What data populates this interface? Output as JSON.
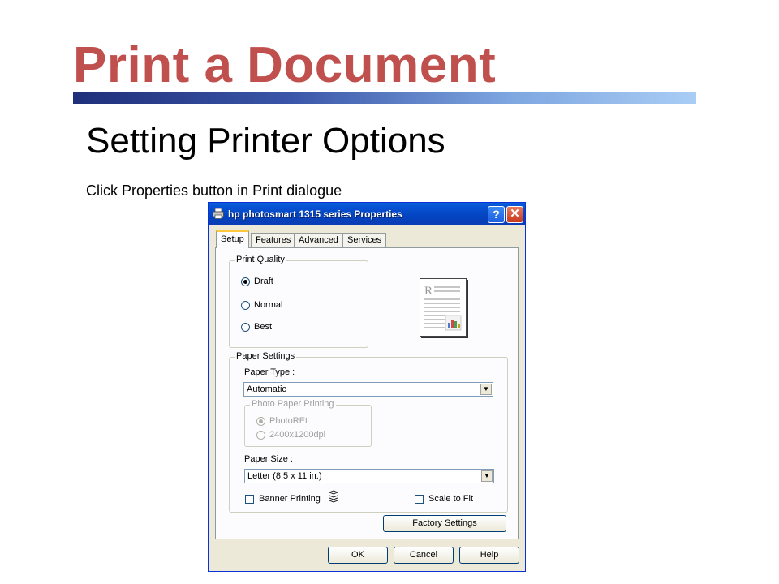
{
  "slide": {
    "title": "Print a Document",
    "subtitle": "Setting Printer Options",
    "instruction": "Click Properties button in Print dialogue"
  },
  "dialog": {
    "title": "hp photosmart 1315 series Properties",
    "help_button": "?",
    "close_button": "✕",
    "tabs": [
      {
        "label": "Setup",
        "active": true
      },
      {
        "label": "Features",
        "active": false
      },
      {
        "label": "Advanced",
        "active": false
      },
      {
        "label": "Services",
        "active": false
      }
    ],
    "print_quality": {
      "legend": "Print Quality",
      "options": [
        {
          "label": "Draft",
          "checked": true
        },
        {
          "label": "Normal",
          "checked": false
        },
        {
          "label": "Best",
          "checked": false
        }
      ]
    },
    "paper_settings": {
      "legend": "Paper Settings",
      "paper_type_label": "Paper Type :",
      "paper_type_value": "Automatic",
      "photo_paper_printing": {
        "legend": "Photo Paper Printing",
        "options": [
          {
            "label": "PhotoREt",
            "checked": true
          },
          {
            "label": "2400x1200dpi",
            "checked": false
          }
        ]
      },
      "paper_size_label": "Paper Size :",
      "paper_size_value": "Letter (8.5 x 11 in.)",
      "banner_printing_label": "Banner Printing",
      "scale_to_fit_label": "Scale to Fit"
    },
    "factory_settings_button": "Factory Settings",
    "ok_button": "OK",
    "cancel_button": "Cancel",
    "help_footer_button": "Help"
  },
  "colors": {
    "title_red": "#c0504d",
    "rule_dark": "#1f2f7a",
    "rule_light": "#a9cdf5",
    "xp_titlebar": "#0a5fd8",
    "xp_face": "#ece9d8"
  },
  "icons": {
    "app": "printer-icon",
    "banner": "stacked-pages-icon",
    "preview": "page-preview-icon"
  }
}
